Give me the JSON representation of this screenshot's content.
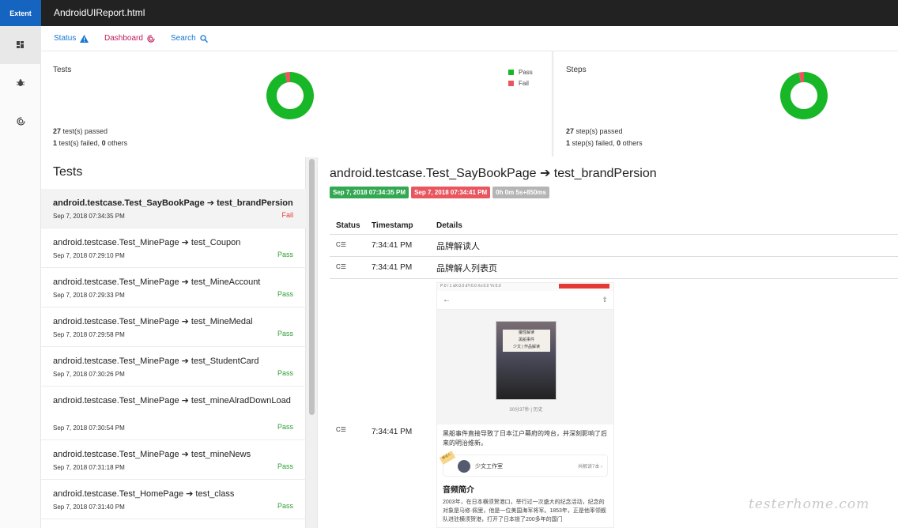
{
  "app": {
    "brand": "Extent",
    "title": "AndroidUIReport.html"
  },
  "subnav": {
    "status_label": "Status",
    "dashboard_label": "Dashboard",
    "search_label": "Search"
  },
  "dashboard": {
    "tests": {
      "title": "Tests",
      "passed_count": "27",
      "passed_text": "test(s) passed",
      "failed_count": "1",
      "failed_text": "test(s) failed,",
      "others_count": "0",
      "others_text": "others"
    },
    "steps": {
      "title": "Steps",
      "passed_count": "27",
      "passed_text": "step(s) passed",
      "failed_count": "1",
      "failed_text": "step(s) failed,",
      "others_count": "0",
      "others_text": "others"
    },
    "legend": [
      {
        "label": "Pass",
        "color": "#18b728"
      },
      {
        "label": "Fail",
        "color": "#e8575f"
      }
    ]
  },
  "chart_data": [
    {
      "type": "pie",
      "title": "Tests",
      "categories": [
        "Pass",
        "Fail"
      ],
      "values": [
        27,
        1
      ]
    },
    {
      "type": "pie",
      "title": "Steps",
      "categories": [
        "Pass",
        "Fail"
      ],
      "values": [
        27,
        1
      ]
    }
  ],
  "test_list": {
    "heading": "Tests",
    "items": [
      {
        "name": "android.testcase.Test_SayBookPage ➔ test_brandPersion",
        "time": "Sep 7, 2018 07:34:35 PM",
        "status": "Fail"
      },
      {
        "name": "android.testcase.Test_MinePage ➔ test_Coupon",
        "time": "Sep 7, 2018 07:29:10 PM",
        "status": "Pass"
      },
      {
        "name": "android.testcase.Test_MinePage ➔ test_MineAccount",
        "time": "Sep 7, 2018 07:29:33 PM",
        "status": "Pass"
      },
      {
        "name": "android.testcase.Test_MinePage ➔ test_MineMedal",
        "time": "Sep 7, 2018 07:29:58 PM",
        "status": "Pass"
      },
      {
        "name": "android.testcase.Test_MinePage ➔ test_StudentCard",
        "time": "Sep 7, 2018 07:30:26 PM",
        "status": "Pass"
      },
      {
        "name": "android.testcase.Test_MinePage ➔ test_mineAlradDownLoad",
        "time": "Sep 7, 2018 07:30:54 PM",
        "status": "Pass"
      },
      {
        "name": "android.testcase.Test_MinePage ➔ test_mineNews",
        "time": "Sep 7, 2018 07:31:18 PM",
        "status": "Pass"
      },
      {
        "name": "android.testcase.Test_HomePage ➔ test_class",
        "time": "Sep 7, 2018 07:31:40 PM",
        "status": "Pass"
      }
    ]
  },
  "detail": {
    "title": "android.testcase.Test_SayBookPage ➔ test_brandPersion",
    "start": "Sep 7, 2018 07:34:35 PM",
    "end": "Sep 7, 2018 07:34:41 PM",
    "duration": "0h 0m 5s+850ms",
    "columns": {
      "status": "Status",
      "timestamp": "Timestamp",
      "details": "Details"
    },
    "logs": [
      {
        "icon": "C☰",
        "time": "7:34:41 PM",
        "details": "品牌解读人"
      },
      {
        "icon": "C☰",
        "time": "7:34:41 PM",
        "details": "品牌解人列表页"
      },
      {
        "icon": "C☰",
        "time": "7:34:41 PM",
        "details": ""
      }
    ]
  },
  "phone": {
    "status_bar": "P:0 / 1        dX:0.0        dY:0.0        Xv:0.0        Yv:0.0",
    "book_label_line1": "黑船事件",
    "book_label_line2": "少文 | 作品解读",
    "book_label_top": "魔性解读",
    "meta": "30分37秒   |   历史",
    "description": "黑船事件直接导致了日本江户幕府的垮台，并深刻影响了后来的明治维新。",
    "author": "少文工作室",
    "author_right": "共解读7本 ›",
    "tag": "解读人",
    "section_title": "音频简介",
    "body": "2003年，在日本横须贺港口，举行过一次盛大的纪念活动，纪念的对象是马修·佩里，他是一位美国海军将军。1853年，正是他率领舰队进驻横须贺港，打开了日本锁了200多年的国门"
  },
  "watermark": "testerhome.com",
  "colors": {
    "pass": "#18b728",
    "fail": "#e8575f",
    "accent": "#1976d2",
    "dashboard": "#c2185b"
  }
}
